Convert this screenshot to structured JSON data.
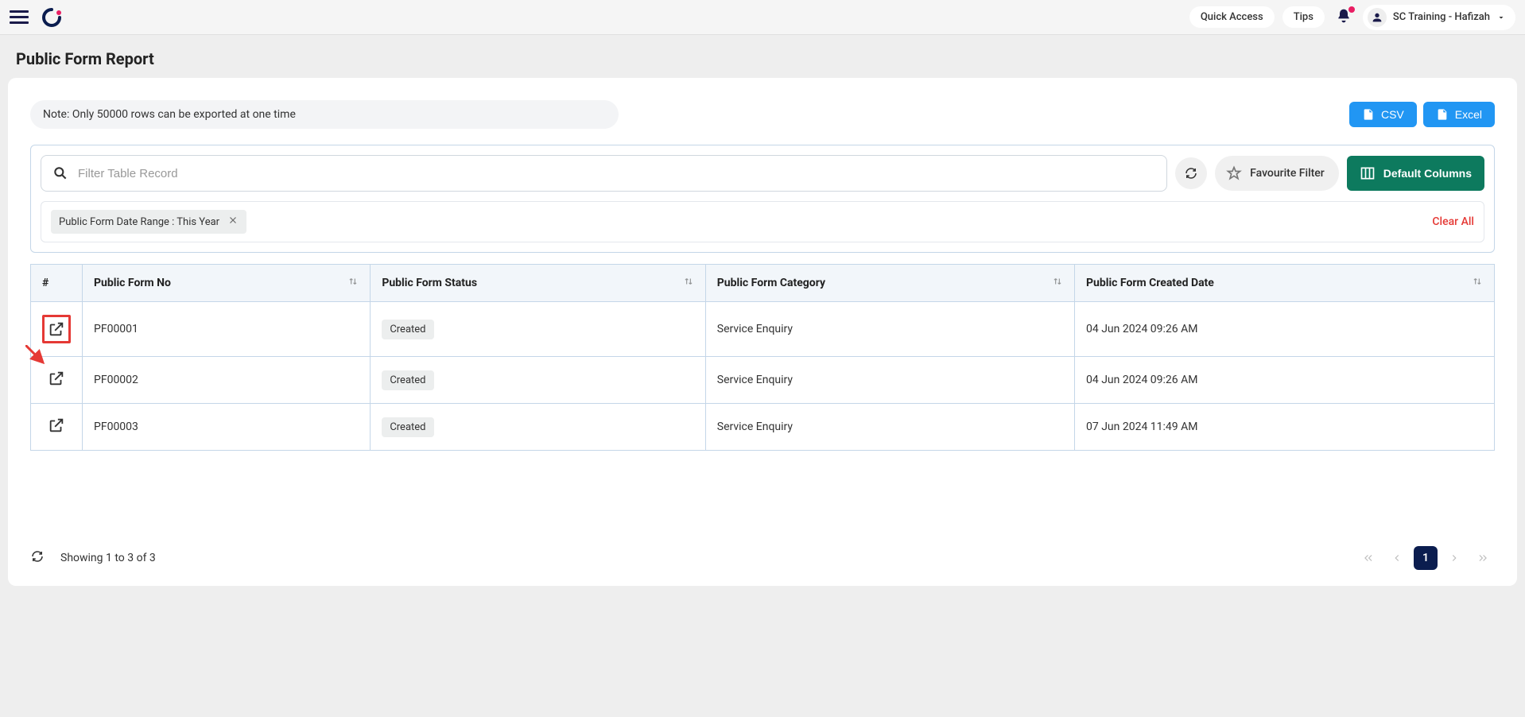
{
  "header": {
    "quick_access": "Quick Access",
    "tips": "Tips",
    "user_name": "SC Training - Hafizah"
  },
  "page_title": "Public Form Report",
  "note": "Note: Only 50000 rows can be exported at one time",
  "buttons": {
    "csv": "CSV",
    "excel": "Excel",
    "favourite_filter": "Favourite Filter",
    "default_columns": "Default Columns",
    "clear_all": "Clear All"
  },
  "search": {
    "placeholder": "Filter Table Record"
  },
  "chip": {
    "label": "Public Form Date Range",
    "value": "This Year"
  },
  "columns": {
    "action": "#",
    "form_no": "Public Form No",
    "status": "Public Form Status",
    "category": "Public Form Category",
    "created": "Public Form Created Date"
  },
  "rows": [
    {
      "form_no": "PF00001",
      "status": "Created",
      "category": "Service Enquiry",
      "created": "04 Jun 2024 09:26 AM"
    },
    {
      "form_no": "PF00002",
      "status": "Created",
      "category": "Service Enquiry",
      "created": "04 Jun 2024 09:26 AM"
    },
    {
      "form_no": "PF00003",
      "status": "Created",
      "category": "Service Enquiry",
      "created": "07 Jun 2024 11:49 AM"
    }
  ],
  "footer": {
    "summary": "Showing 1 to 3 of 3",
    "current_page": "1"
  }
}
